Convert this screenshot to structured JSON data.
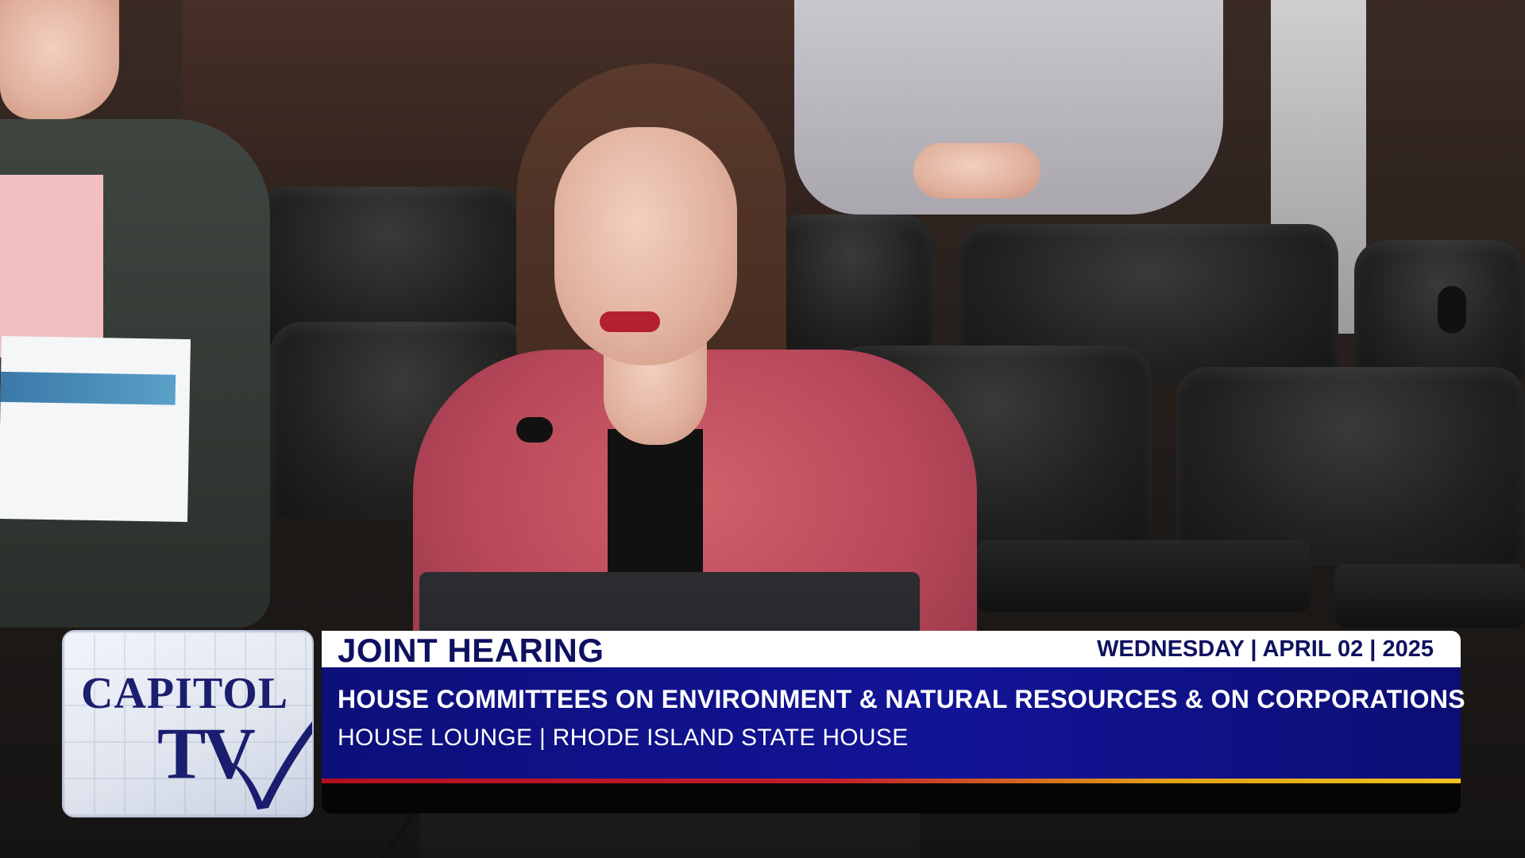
{
  "scene": {
    "description_colors": {
      "blazer": "#c4505f",
      "chair": "#1d1d1d",
      "wall": "#3b2a24"
    }
  },
  "lower_third": {
    "logo": {
      "line1": "CAPITOL",
      "line2": "TV",
      "colors": {
        "text": "#1b1e6e",
        "bg": "#e4e8f1"
      }
    },
    "title": "JOINT HEARING",
    "date": "WEDNESDAY | APRIL 02 | 2025",
    "committee": "HOUSE COMMITTEES ON ENVIRONMENT & NATURAL RESOURCES & ON CORPORATIONS",
    "location": "HOUSE LOUNGE | RHODE ISLAND STATE HOUSE",
    "colors": {
      "banner": "#11138f",
      "title_text": "#0f1160",
      "stripe_red": "#c21e2c",
      "stripe_gold": "#f0c020"
    }
  }
}
